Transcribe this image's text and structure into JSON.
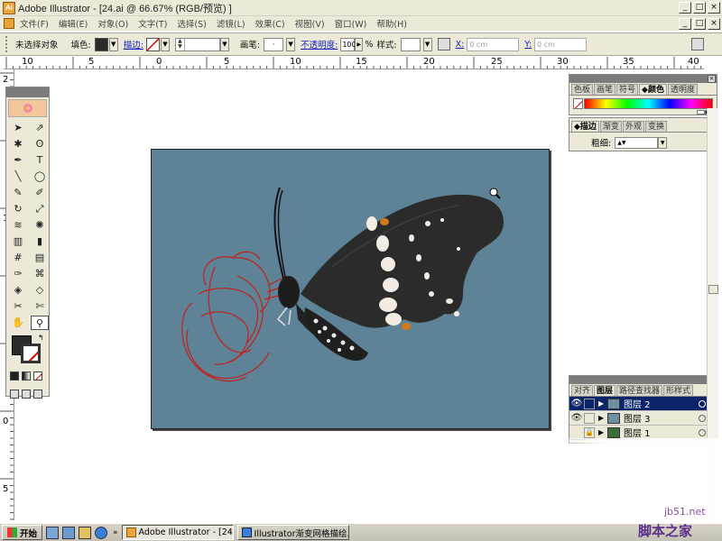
{
  "window": {
    "title": "Adobe Illustrator - [24.ai @ 66.67% (RGB/预览) ]",
    "app_icon": "Ai",
    "controls": [
      "_",
      "□",
      "×"
    ],
    "doc_controls": [
      "_",
      "□",
      "×"
    ]
  },
  "menu": [
    "文件(F)",
    "编辑(E)",
    "对象(O)",
    "文字(T)",
    "选择(S)",
    "滤镜(L)",
    "效果(C)",
    "视图(V)",
    "窗口(W)",
    "帮助(H)"
  ],
  "control_bar": {
    "no_selection": "未选择对象",
    "fill_label": "填色:",
    "stroke_label": "描边:",
    "brush_label": "画笔:",
    "opacity_label": "不透明度:",
    "opacity_value": "100",
    "percent": "%",
    "style_label": "样式:",
    "x_label": "X:",
    "x_value": "0 cm",
    "y_label": "Y:",
    "y_value": "0 cm",
    "fill_color": "#2a2a2a"
  },
  "ruler": {
    "top": [
      "10",
      "5",
      "0",
      "5",
      "10",
      "15",
      "20",
      "25",
      "30",
      "35",
      "40"
    ],
    "left": [
      "2",
      "1",
      "0",
      "5"
    ]
  },
  "artboard": {
    "background": "#5e8396"
  },
  "toolbox": {
    "tools": [
      "selection-arrow",
      "direct-selection",
      "magic-wand",
      "lasso",
      "pen",
      "type",
      "line",
      "ellipse",
      "paintbrush",
      "pencil",
      "rotate",
      "scale",
      "warp",
      "symbol-sprayer",
      "graph",
      "column-graph",
      "mesh",
      "gradient",
      "eyedropper",
      "blend",
      "live-paint",
      "live-paint-select",
      "slice",
      "scissors",
      "hand",
      "zoom"
    ],
    "tool_glyphs": [
      "➤",
      "⇗",
      "✱",
      "ʘ",
      "✒",
      "T",
      "╲",
      "◯",
      "✎",
      "✐",
      "↻",
      "⤢",
      "≋",
      "✺",
      "▥",
      "▮",
      "#",
      "▤",
      "✑",
      "⌘",
      "◈",
      "◇",
      "✂",
      "✄",
      "✋",
      "⚲"
    ]
  },
  "color_panel": {
    "tabs": [
      "色板",
      "画笔",
      "符号",
      "◆颜色",
      "透明度"
    ],
    "active_tab": "◆颜色"
  },
  "stroke_panel": {
    "tabs": [
      "◆描边",
      "渐变",
      "外观",
      "变换"
    ],
    "weight_label": "粗细:"
  },
  "layers_panel": {
    "tabs": [
      "对齐",
      "图层",
      "路径查找器",
      "形样式"
    ],
    "layers": [
      {
        "name": "图层 2",
        "selected": true
      },
      {
        "name": "图层 3",
        "selected": false
      },
      {
        "name": "图层 1",
        "selected": false
      }
    ]
  },
  "taskbar": {
    "start": "开始",
    "tasks": [
      "Adobe Illustrator - [24.ai ...",
      "Illustrator渐变网格描绘..."
    ]
  },
  "watermark": {
    "url": "jb51.net",
    "brand": "脚本之家"
  }
}
